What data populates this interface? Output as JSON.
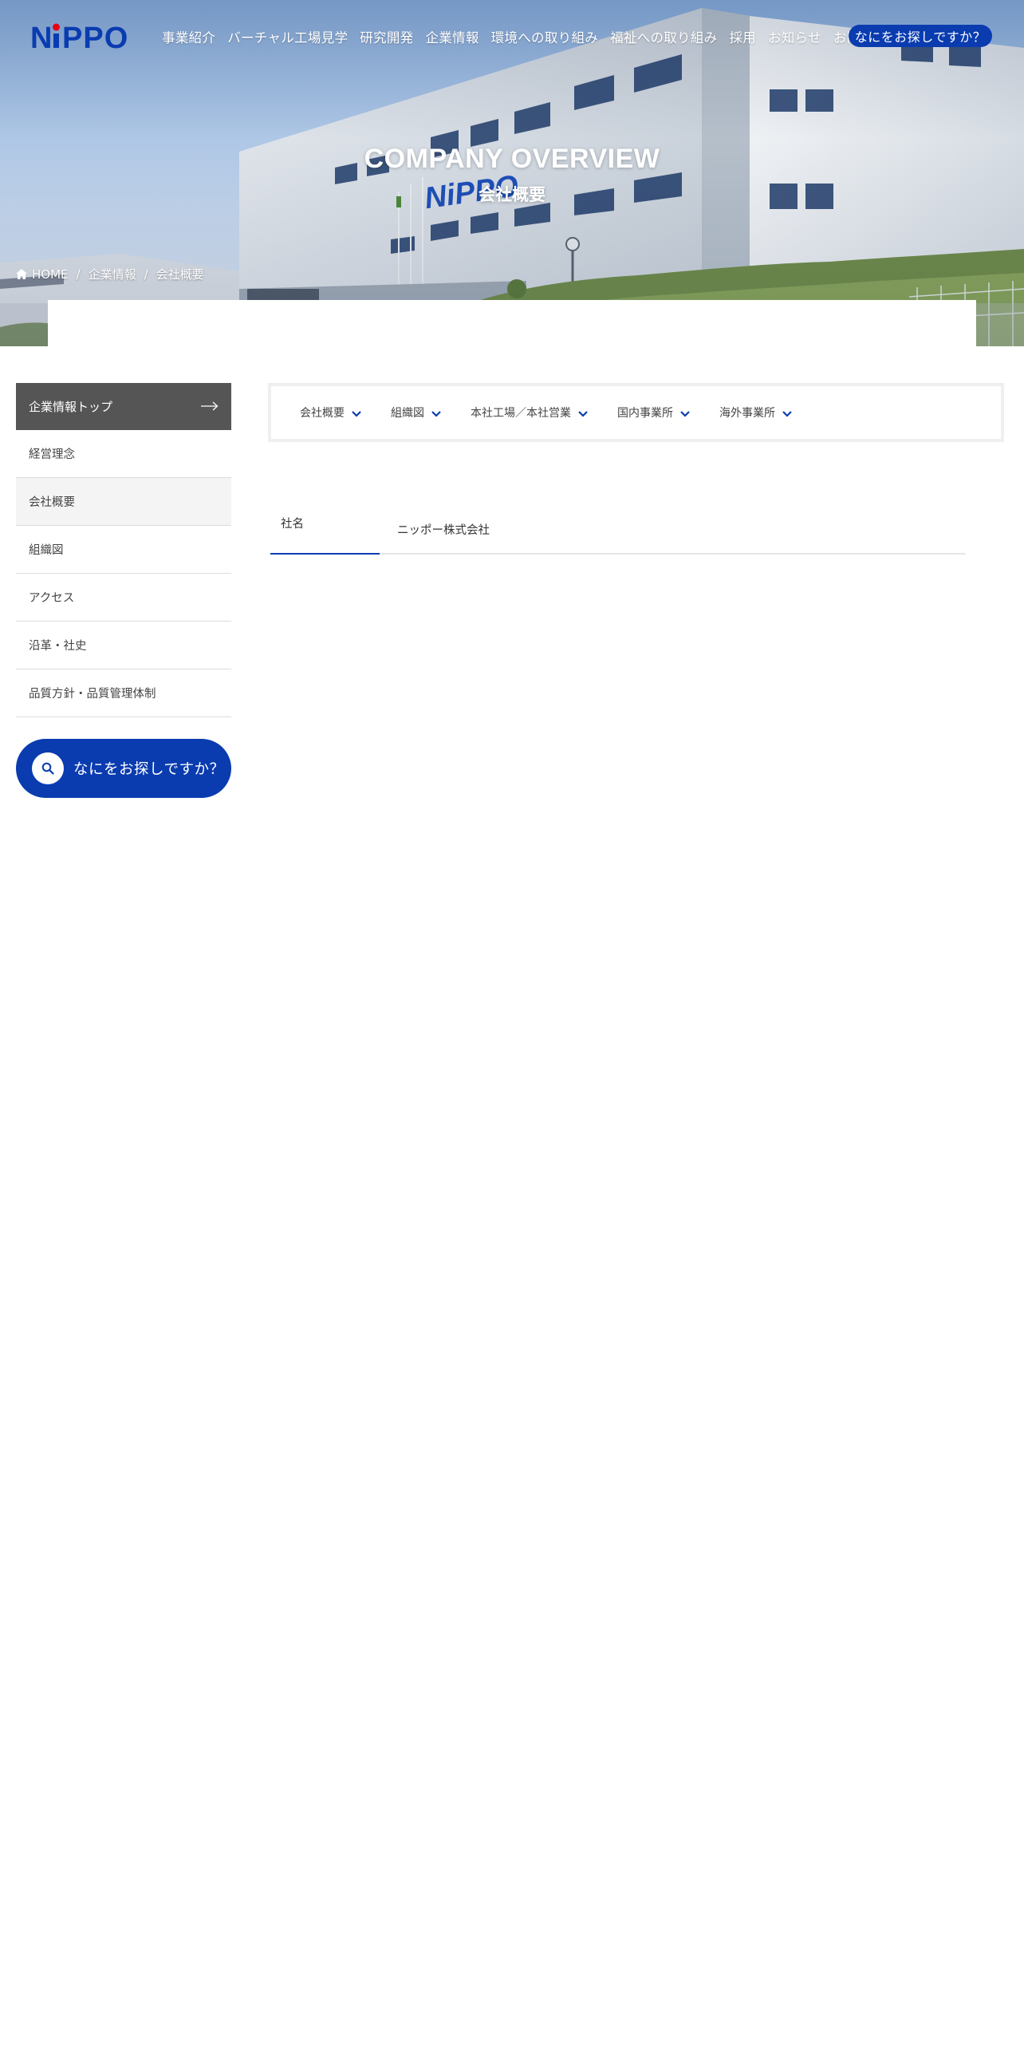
{
  "header": {
    "logo_text": "NiPPO",
    "nav": [
      "事業紹介",
      "バーチャル工場見学",
      "研究開発",
      "企業情報",
      "環境への取り組み",
      "福祉への取り組み",
      "採用",
      "お知らせ",
      "お問い合わせ"
    ],
    "search_label": "なにをお探しですか？"
  },
  "hero": {
    "title_en": "COMPANY OVERVIEW",
    "title_ja": "会社概要",
    "building_sign": "NiPPO"
  },
  "breadcrumb": {
    "home": "HOME",
    "items": [
      "企業情報",
      "会社概要"
    ],
    "separator": "/"
  },
  "sidebar": {
    "top_label": "企業情報トップ",
    "items": [
      {
        "label": "経営理念",
        "active": false
      },
      {
        "label": "会社概要",
        "active": true
      },
      {
        "label": "組織図",
        "active": false
      },
      {
        "label": "アクセス",
        "active": false
      },
      {
        "label": "沿革・社史",
        "active": false
      },
      {
        "label": "品質方針・品質管理体制",
        "active": false
      }
    ],
    "search_label": "なにをお探しですか？"
  },
  "tabs": [
    "会社概要",
    "組織図",
    "本社工場／本社営業",
    "国内事業所",
    "海外事業所"
  ],
  "company_table": [
    {
      "label": "社名",
      "value": "ニッポー株式会社"
    }
  ],
  "colors": {
    "brand_blue": "#0a3cb0",
    "logo_red": "#e60012",
    "sidebar_top_bg": "#555555"
  }
}
